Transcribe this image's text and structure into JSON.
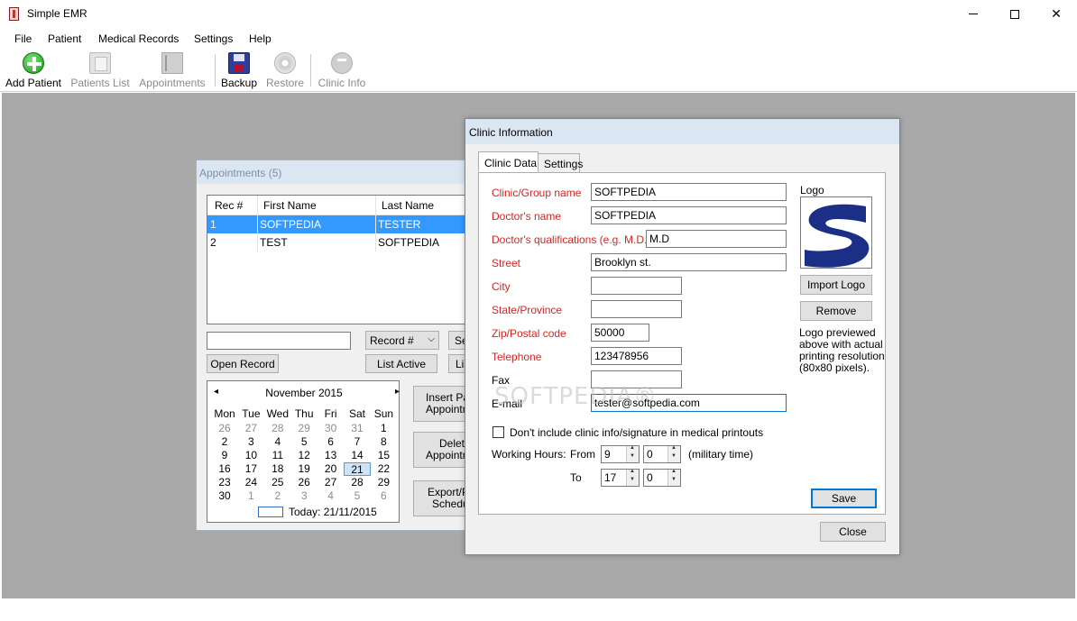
{
  "window": {
    "title": "Simple EMR"
  },
  "menu": [
    "File",
    "Patient",
    "Medical Records",
    "Settings",
    "Help"
  ],
  "toolbar": {
    "add_patient": "Add Patient",
    "patients_list": "Patients List",
    "appointments": "Appointments",
    "backup": "Backup",
    "restore": "Restore",
    "clinic_info": "Clinic Info"
  },
  "appointments": {
    "title": "Appointments (5)",
    "columns": [
      "Rec #",
      "First Name",
      "Last Name"
    ],
    "rows": [
      {
        "rec": "1",
        "first": "SOFTPEDIA",
        "last": "TESTER"
      },
      {
        "rec": "2",
        "first": "TEST",
        "last": "SOFTPEDIA"
      }
    ],
    "search_value": "",
    "record_combo": "Record #",
    "search_btn": "Se",
    "open_record": "Open Record",
    "list_active": "List Active",
    "list_btn": "Lis",
    "insert_btn_1": "Insert Pat",
    "insert_btn_2": "Appointm",
    "delete_btn_1": "Delete",
    "delete_btn_2": "Appointm",
    "export_btn_1": "Export/P",
    "export_btn_2": "Schedu",
    "calendar": {
      "prev": "◂",
      "next": "▸",
      "month": "November 2015",
      "dows": [
        "Mon",
        "Tue",
        "Wed",
        "Thu",
        "Fri",
        "Sat",
        "Sun"
      ],
      "weeks": [
        [
          "26",
          "27",
          "28",
          "29",
          "30",
          "31",
          "1"
        ],
        [
          "2",
          "3",
          "4",
          "5",
          "6",
          "7",
          "8"
        ],
        [
          "9",
          "10",
          "11",
          "12",
          "13",
          "14",
          "15"
        ],
        [
          "16",
          "17",
          "18",
          "19",
          "20",
          "21",
          "22"
        ],
        [
          "23",
          "24",
          "25",
          "26",
          "27",
          "28",
          "29"
        ],
        [
          "30",
          "1",
          "2",
          "3",
          "4",
          "5",
          "6"
        ]
      ],
      "today": "Today: 21/11/2015"
    }
  },
  "clinic": {
    "title": "Clinic Information",
    "tabs": [
      "Clinic Data",
      "Settings"
    ],
    "labels": {
      "group_name": "Clinic/Group name",
      "doctor_name": "Doctor's name",
      "qualifications": "Doctor's qualifications (e.g. M.D.)",
      "street": "Street",
      "city": "City",
      "state": "State/Province",
      "zip": "Zip/Postal code",
      "telephone": "Telephone",
      "fax": "Fax",
      "email": "E-mail"
    },
    "values": {
      "group_name": "SOFTPEDIA",
      "doctor_name": "SOFTPEDIA",
      "qualifications": "M.D",
      "street": "Brooklyn st.",
      "city": "",
      "state": "",
      "zip": "50000",
      "telephone": "123478956",
      "fax": "",
      "email": "tester@softpedia.com"
    },
    "logo_label": "Logo",
    "import_logo": "Import Logo",
    "remove": "Remove",
    "logo_note": "Logo previewed above with actual printing resolution (80x80 pixels).",
    "dont_include": "Don't include clinic info/signature in medical printouts",
    "working_hours": "Working Hours:",
    "from": "From",
    "to": "To",
    "from_hour": "9",
    "from_min": "0",
    "to_hour": "17",
    "to_min": "0",
    "military": "(military time)",
    "save": "Save",
    "close": "Close"
  },
  "watermark": "SOFTPEDIA®"
}
